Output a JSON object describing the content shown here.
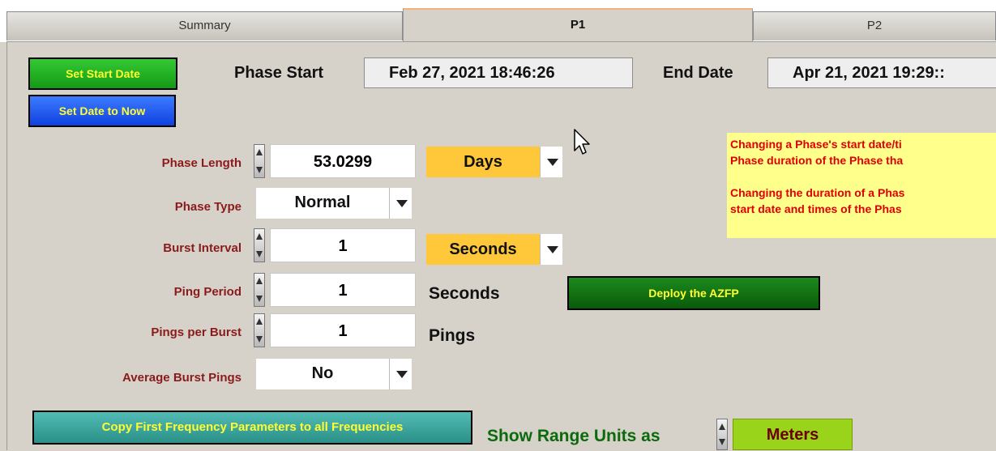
{
  "tabs": [
    {
      "label": "Summary"
    },
    {
      "label": "P1"
    },
    {
      "label": "P2"
    }
  ],
  "buttons": {
    "set_start_date": "Set Start Date",
    "set_date_now": "Set Date to Now",
    "deploy": "Deploy the AZFP",
    "copy_freq": "Copy First Frequency Parameters to all Frequencies"
  },
  "header": {
    "phase_start_label": "Phase Start",
    "phase_start_value": "Feb 27, 2021 18:46:26",
    "end_date_label": "End Date",
    "end_date_value": "Apr 21, 2021 19:29::"
  },
  "form": {
    "phase_length": {
      "label": "Phase Length",
      "value": "53.0299",
      "unit": "Days"
    },
    "phase_type": {
      "label": "Phase Type",
      "value": "Normal"
    },
    "burst_interval": {
      "label": "Burst Interval",
      "value": "1",
      "unit": "Seconds"
    },
    "ping_period": {
      "label": "Ping Period",
      "value": "1",
      "unit": "Seconds"
    },
    "pings_per_burst": {
      "label": "Pings per Burst",
      "value": "1",
      "unit": "Pings"
    },
    "average_burst_pings": {
      "label": "Average Burst Pings",
      "value": "No"
    }
  },
  "note": {
    "line1": "Changing a Phase's start date/ti",
    "line2": "Phase duration of the Phase tha",
    "line3": "Changing the duration of a Phas",
    "line4": "start date and times of the Phas"
  },
  "range": {
    "label": "Show Range Units as",
    "value": "Meters"
  },
  "colors": {
    "green_button": "#22b322",
    "blue_button": "#1a5cff",
    "yellow_text": "#ffff33",
    "dark_green_button": "#0f6a10",
    "teal_button": "#38a8a0",
    "orange_dropdown": "#ffc83a",
    "lime_box": "#99d41a",
    "note_bg": "#ffff8c",
    "note_text": "#e00000",
    "red_label": "#8b1a1a"
  }
}
